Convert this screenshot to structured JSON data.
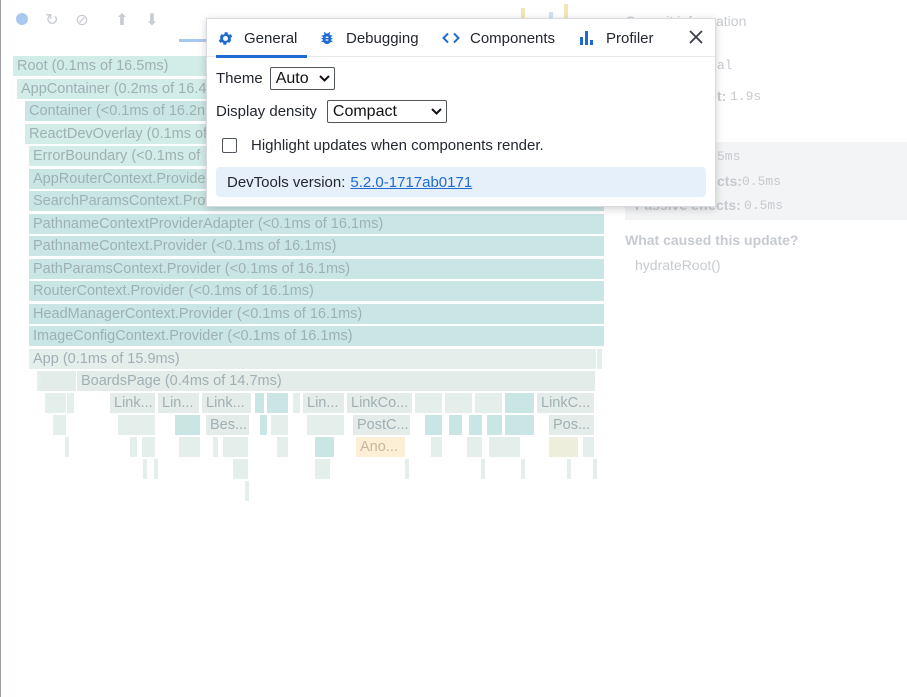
{
  "settings": {
    "tabs": [
      {
        "label": "General",
        "icon": "gear-icon",
        "active": true
      },
      {
        "label": "Debugging",
        "icon": "bug-icon",
        "active": false
      },
      {
        "label": "Components",
        "icon": "code-brackets-icon",
        "active": false
      },
      {
        "label": "Profiler",
        "icon": "bar-chart-icon",
        "active": false
      }
    ],
    "theme_label": "Theme",
    "theme_value": "Auto",
    "density_label": "Display density",
    "density_value": "Compact",
    "highlight_label": "Highlight updates when components render.",
    "highlight_checked": false,
    "version_label": "DevTools version:",
    "version_value": "5.2.0-1717ab0171"
  },
  "flamegraph": {
    "frames": [
      "Root (0.1ms of 16.5ms)",
      "AppContainer (0.2ms of 16.4",
      "Container (<0.1ms of 16.2n",
      "ReactDevOverlay (0.1ms of",
      "ErrorBoundary (<0.1ms of",
      "AppRouterContext.Provide",
      "SearchParamsContext.Prov",
      "PathnameContextProviderAdapter (<0.1ms of 16.1ms)",
      "PathnameContext.Provider (<0.1ms of 16.1ms)",
      "PathParamsContext.Provider (<0.1ms of 16.1ms)",
      "RouterContext.Provider (<0.1ms of 16.1ms)",
      "HeadManagerContext.Provider (<0.1ms of 16.1ms)",
      "ImageConfigContext.Provider (<0.1ms of 16.1ms)",
      "App (0.1ms of 15.9ms)",
      "BoardsPage (0.4ms of 14.7ms)"
    ],
    "small_labels": [
      "Link...",
      "Lin...",
      "Link...",
      "Lin...",
      "LinkCo...",
      "LinkC...",
      "Bes...",
      "PostC...",
      "Pos...",
      "Ano..."
    ]
  },
  "commit_info": {
    "title": "Commit information",
    "line1_key": "al",
    "line2_key": "t:",
    "line2_val": "1.9s",
    "row1_val": "5ms",
    "row2_key": "cts:",
    "row2_val": "0.5ms",
    "row3_key": "Passive effects:",
    "row3_val": "0.5ms",
    "cause_title": "What caused this update?",
    "cause_value": "hydrateRoot()"
  }
}
